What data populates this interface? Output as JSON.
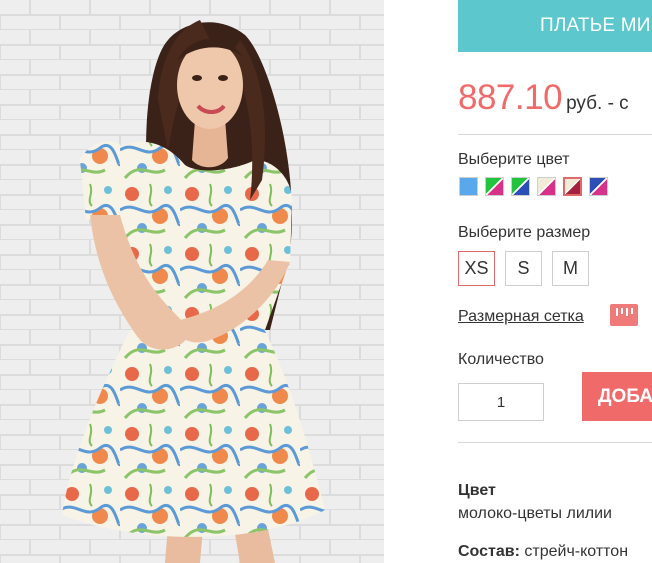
{
  "product": {
    "title": "ПЛАТЬЕ МИ",
    "price": "887.10",
    "currency": "руб. - с",
    "image_alt": "model wearing floral short-sleeve dress"
  },
  "color_picker": {
    "label": "Выберите цвет",
    "swatches": [
      {
        "name": "blue",
        "colors": [
          "#5aa8ec",
          "#5aa8ec"
        ]
      },
      {
        "name": "green-pink",
        "colors": [
          "#21c43c",
          "#d8318a"
        ]
      },
      {
        "name": "green-blue",
        "colors": [
          "#21c43c",
          "#2b4fb6"
        ]
      },
      {
        "name": "cream-pink",
        "colors": [
          "#f1ecd8",
          "#d8318a"
        ]
      },
      {
        "name": "cream-wine",
        "colors": [
          "#f1ecd8",
          "#a5223f"
        ]
      },
      {
        "name": "blue-pink",
        "colors": [
          "#2b4fb6",
          "#d8318a"
        ]
      }
    ],
    "selected_index": 4
  },
  "size_picker": {
    "label": "Выберите размер",
    "sizes": [
      "XS",
      "S",
      "M"
    ],
    "selected": "XS"
  },
  "size_chart_link": "Размерная сетка",
  "quantity": {
    "label": "Количество",
    "value": "1"
  },
  "add_button": "ДОБАВ",
  "specs": {
    "color_heading": "Цвет",
    "color_value": "молоко-цветы лилии",
    "composition_heading": "Состав:",
    "composition_value": "стрейч-коттон"
  },
  "theme": {
    "accent": "#5cc7cc",
    "price_color": "#f06a6a",
    "button_color": "#f06a6a"
  }
}
